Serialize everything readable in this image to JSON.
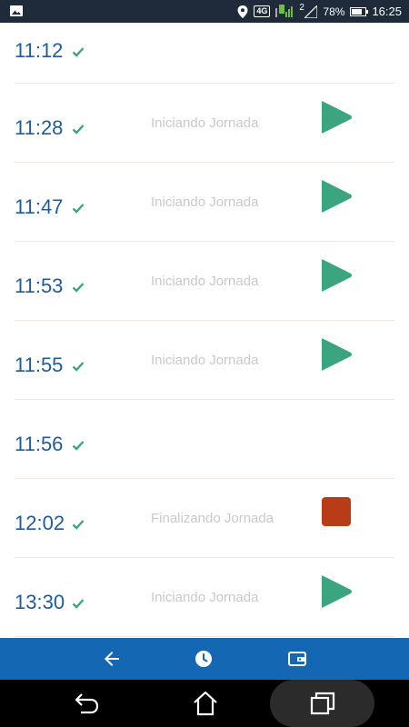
{
  "status_bar": {
    "network": "4G",
    "sim_slot": "2",
    "battery": "78%",
    "battery_level": 0.78,
    "clock": "16:25",
    "icons": [
      "image-icon",
      "location-icon",
      "signal-icon",
      "battery-icon"
    ]
  },
  "entries": [
    {
      "time": "11:12",
      "status": "",
      "action": "none"
    },
    {
      "time": "11:28",
      "status": "Iniciando Jornada",
      "action": "play"
    },
    {
      "time": "11:47",
      "status": "Iniciando Jornada",
      "action": "play"
    },
    {
      "time": "11:53",
      "status": "Iniciando Jornada",
      "action": "play"
    },
    {
      "time": "11:55",
      "status": "Iniciando Jornada",
      "action": "play"
    },
    {
      "time": "11:56",
      "status": "",
      "action": "none"
    },
    {
      "time": "12:02",
      "status": "Finalizando Jornada",
      "action": "stop"
    },
    {
      "time": "13:30",
      "status": "Iniciando Jornada",
      "action": "play"
    }
  ],
  "app_nav": {
    "items": [
      "back-arrow-icon",
      "clock-icon",
      "wallet-icon"
    ]
  },
  "colors": {
    "time_text": "#1f5c9a",
    "check": "#3aa57e",
    "play": "#3aa57e",
    "stop": "#b83c17",
    "app_nav_bg": "#1467b3",
    "status_bar_bg": "#1f2a3a"
  }
}
